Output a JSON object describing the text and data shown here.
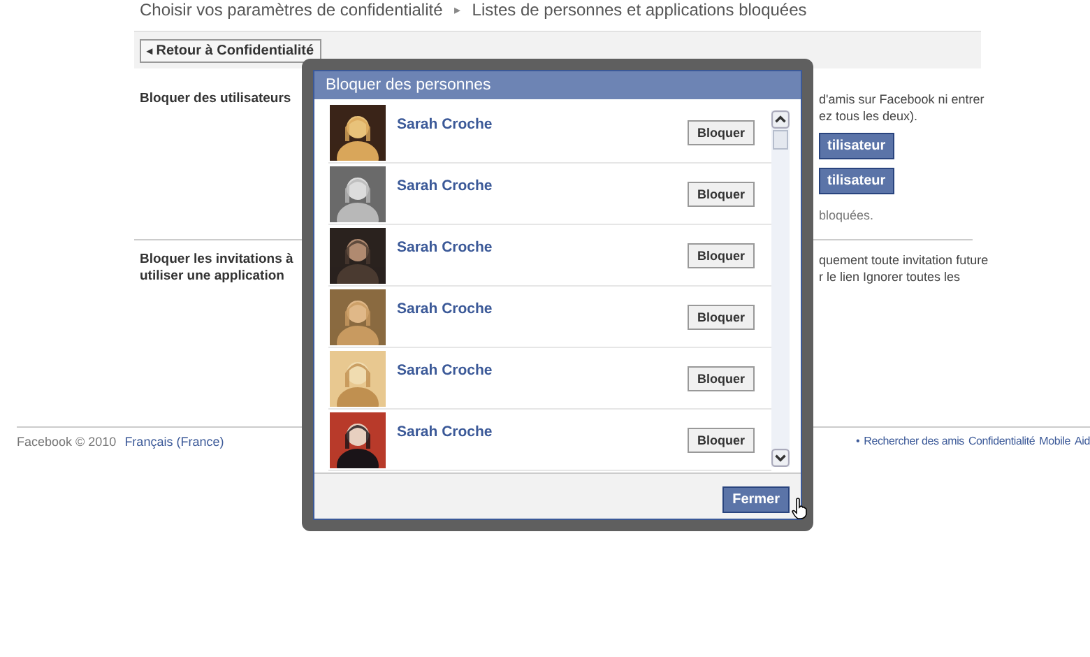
{
  "breadcrumb": {
    "parent": "Choisir vos paramètres de confidentialité",
    "separator": "▸",
    "current": "Listes de personnes et applications bloquées"
  },
  "back_button": {
    "icon": "◂",
    "label": "Retour à Confidentialité"
  },
  "sections": [
    {
      "label": "Bloquer des utilisateurs",
      "lines": [
        "d'amis sur Facebook ni entrer",
        "ez tous les deux)."
      ],
      "buttons": [
        "tilisateur",
        "tilisateur"
      ],
      "note": "bloquées."
    },
    {
      "label": "Bloquer les invitations à utiliser une application",
      "lines": [
        "quement toute invitation future",
        "r le lien Ignorer toutes les"
      ]
    }
  ],
  "footer": {
    "left": [
      "Facebook © 2010",
      "Français (France)"
    ],
    "right": [
      "•",
      "Rechercher des amis",
      "Confidentialité",
      "Mobile",
      "Aid"
    ]
  },
  "dialog": {
    "title": "Bloquer des personnes",
    "close_button": "Fermer",
    "people": [
      {
        "name": "Sarah Croche",
        "button": "Bloquer"
      },
      {
        "name": "Sarah Croche",
        "button": "Bloquer"
      },
      {
        "name": "Sarah Croche",
        "button": "Bloquer"
      },
      {
        "name": "Sarah Croche",
        "button": "Bloquer"
      },
      {
        "name": "Sarah Croche",
        "button": "Bloquer"
      },
      {
        "name": "Sarah Croche",
        "button": "Bloquer"
      }
    ]
  }
}
